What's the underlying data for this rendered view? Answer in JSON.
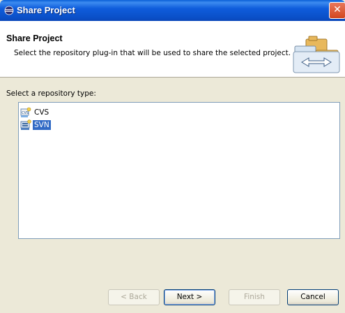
{
  "window": {
    "title": "Share Project",
    "close_glyph": "✕"
  },
  "header": {
    "title": "Share Project",
    "description": "Select the repository plug-in that will be used to share the selected project."
  },
  "body": {
    "section_label": "Select a repository type:",
    "repositories": [
      {
        "label": "CVS",
        "icon": "cvs-repository-icon",
        "selected": false
      },
      {
        "label": "SVN",
        "icon": "svn-repository-icon",
        "selected": true
      }
    ]
  },
  "buttons": {
    "back": "< Back",
    "next": "Next >",
    "finish": "Finish",
    "cancel": "Cancel"
  },
  "colors": {
    "titlebar": "#0a5fd8",
    "selection": "#316ac5",
    "dialog_bg": "#ece9d8"
  }
}
